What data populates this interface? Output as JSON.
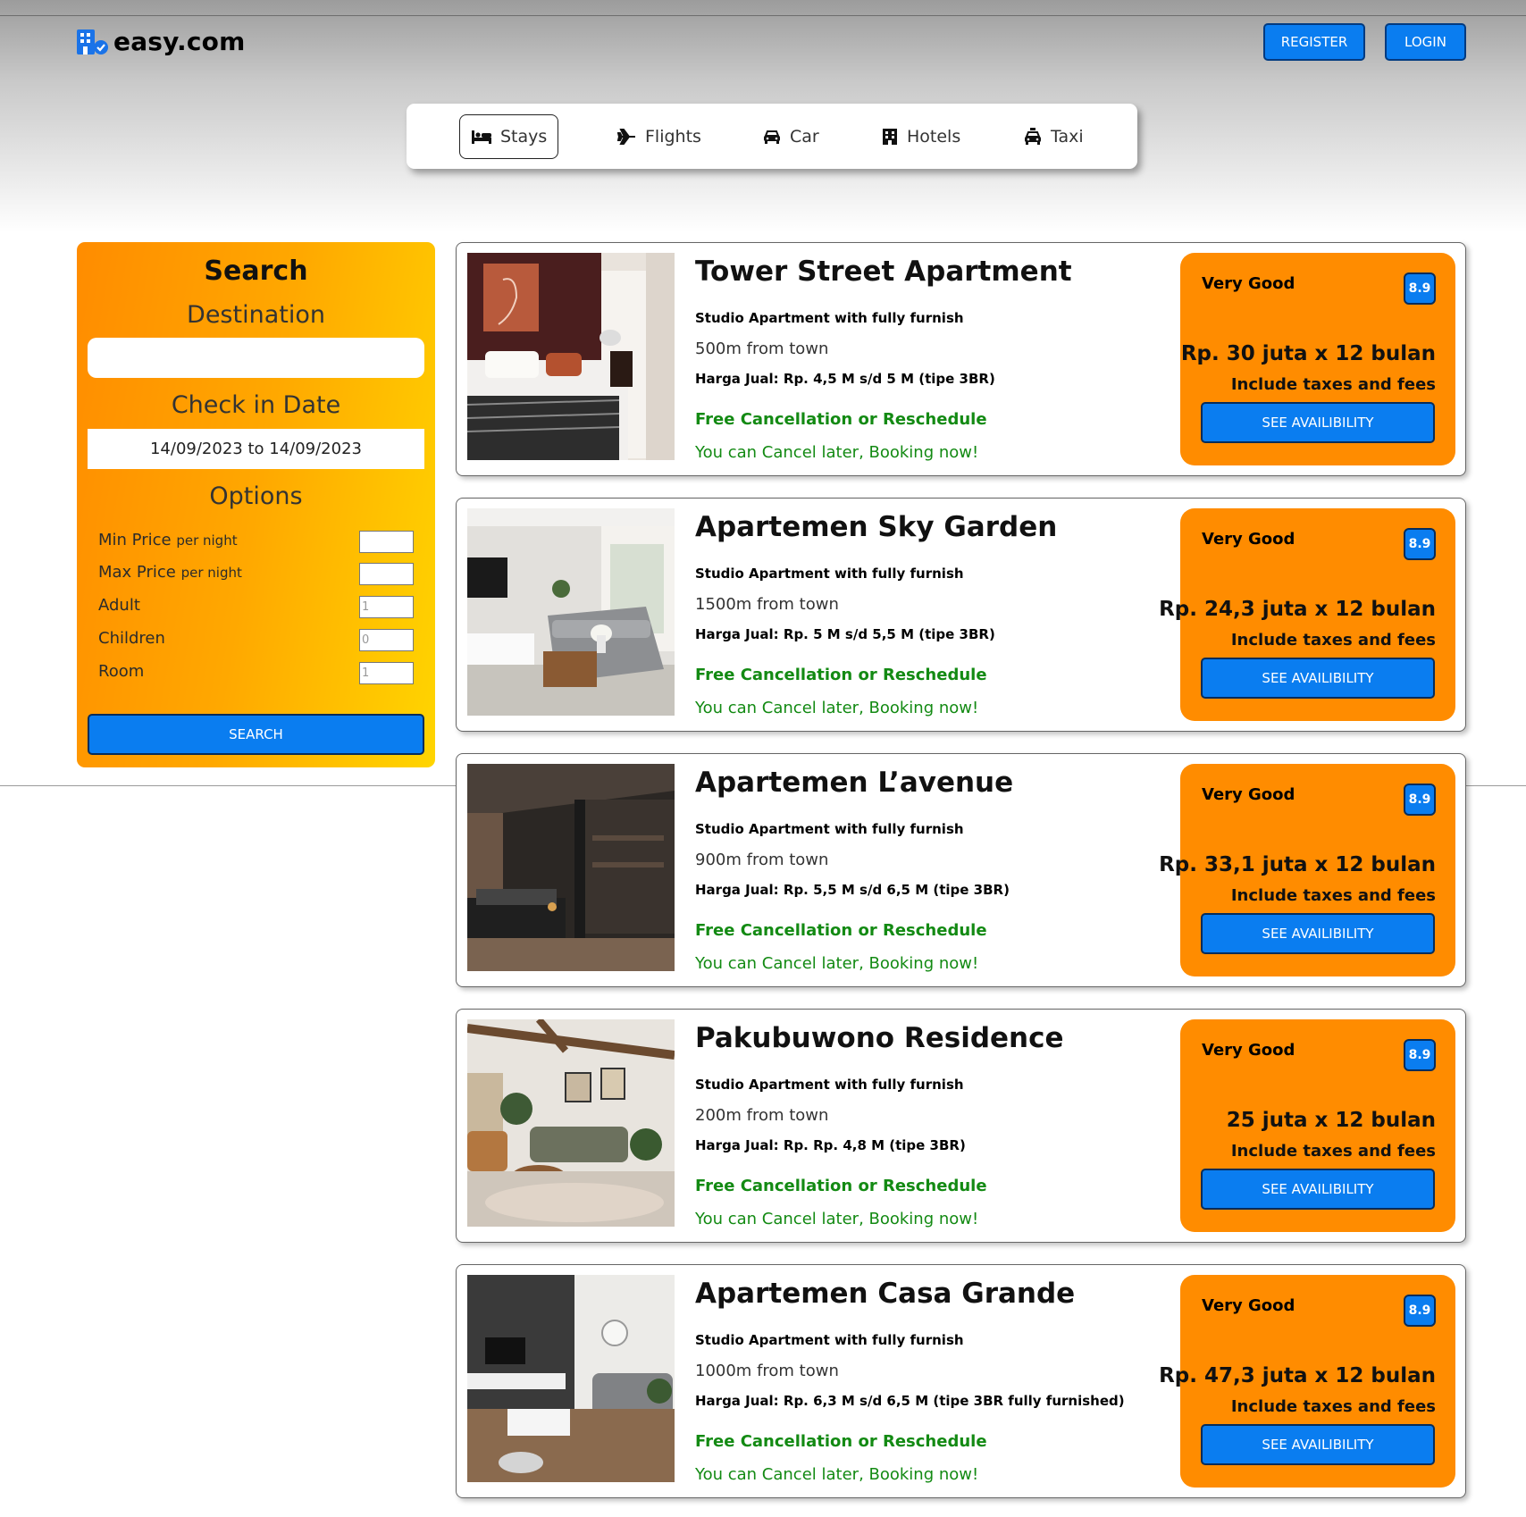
{
  "header": {
    "brand": "easy.com",
    "register_label": "REGISTER",
    "login_label": "LOGIN"
  },
  "nav": {
    "tabs": [
      {
        "label": "Stays",
        "icon": "bed-icon",
        "active": true
      },
      {
        "label": "Flights",
        "icon": "plane-icon",
        "active": false
      },
      {
        "label": "Car",
        "icon": "car-icon",
        "active": false
      },
      {
        "label": "Hotels",
        "icon": "building-icon",
        "active": false
      },
      {
        "label": "Taxi",
        "icon": "taxi-icon",
        "active": false
      }
    ]
  },
  "search": {
    "title": "Search",
    "destination_label": "Destination",
    "destination_value": "",
    "checkin_label": "Check in Date",
    "checkin_value": "14/09/2023 to 14/09/2023",
    "options_label": "Options",
    "options": [
      {
        "label": "Min Price",
        "suffix": "per night",
        "value": ""
      },
      {
        "label": "Max Price",
        "suffix": "per night",
        "value": ""
      },
      {
        "label": "Adult",
        "suffix": "",
        "value": "1"
      },
      {
        "label": "Children",
        "suffix": "",
        "value": "0"
      },
      {
        "label": "Room",
        "suffix": "",
        "value": "1"
      }
    ],
    "button_label": "SEARCH"
  },
  "listings": [
    {
      "title": "Tower Street Apartment",
      "subtitle": "Studio Apartment with fully furnish",
      "distance": "500m from town",
      "price_info": "Harga Jual: Rp. 4,5 M s/d 5 M (tipe 3BR)",
      "free_cancel": "Free Cancellation or Reschedule",
      "cancel_later": "You can Cancel later, Booking now!",
      "rating_label": "Very Good",
      "score": "8.9",
      "price": "Rp. 30 juta x 12 bulan",
      "taxes": "Include taxes and fees",
      "button": "SEE AVAILIBILITY"
    },
    {
      "title": "Apartemen Sky Garden",
      "subtitle": "Studio Apartment with fully furnish",
      "distance": "1500m from town",
      "price_info": "Harga Jual: Rp. 5 M s/d 5,5 M (tipe 3BR)",
      "free_cancel": "Free Cancellation or Reschedule",
      "cancel_later": "You can Cancel later, Booking now!",
      "rating_label": "Very Good",
      "score": "8.9",
      "price": "Rp. 24,3 juta x 12 bulan",
      "taxes": "Include taxes and fees",
      "button": "SEE AVAILIBILITY"
    },
    {
      "title": "Apartemen L’avenue",
      "subtitle": "Studio Apartment with fully furnish",
      "distance": "900m from town",
      "price_info": "Harga Jual: Rp. 5,5 M s/d 6,5 M (tipe 3BR)",
      "free_cancel": "Free Cancellation or Reschedule",
      "cancel_later": "You can Cancel later, Booking now!",
      "rating_label": "Very Good",
      "score": "8.9",
      "price": "Rp. 33,1 juta x 12 bulan",
      "taxes": "Include taxes and fees",
      "button": "SEE AVAILIBILITY"
    },
    {
      "title": "Pakubuwono Residence",
      "subtitle": "Studio Apartment with fully furnish",
      "distance": "200m from town",
      "price_info": "Harga Jual: Rp. Rp. 4,8 M (tipe 3BR)",
      "free_cancel": "Free Cancellation or Reschedule",
      "cancel_later": "You can Cancel later, Booking now!",
      "rating_label": "Very Good",
      "score": "8.9",
      "price": "25 juta x 12 bulan",
      "taxes": "Include taxes and fees",
      "button": "SEE AVAILIBILITY"
    },
    {
      "title": "Apartemen Casa Grande",
      "subtitle": "Studio Apartment with fully furnish",
      "distance": "1000m from town",
      "price_info": "Harga Jual: Rp. 6,3 M s/d 6,5 M (tipe 3BR fully furnished)",
      "free_cancel": "Free Cancellation or Reschedule",
      "cancel_later": "You can Cancel later, Booking now!",
      "rating_label": "Very Good",
      "score": "8.9",
      "price": "Rp. 47,3 juta x 12 bulan",
      "taxes": "Include taxes and fees",
      "button": "SEE AVAILIBILITY"
    }
  ],
  "colors": {
    "accent_blue": "#0a7df0",
    "orange": "#ff8c00",
    "yellow": "#ffd500",
    "green_text": "#138a13"
  }
}
